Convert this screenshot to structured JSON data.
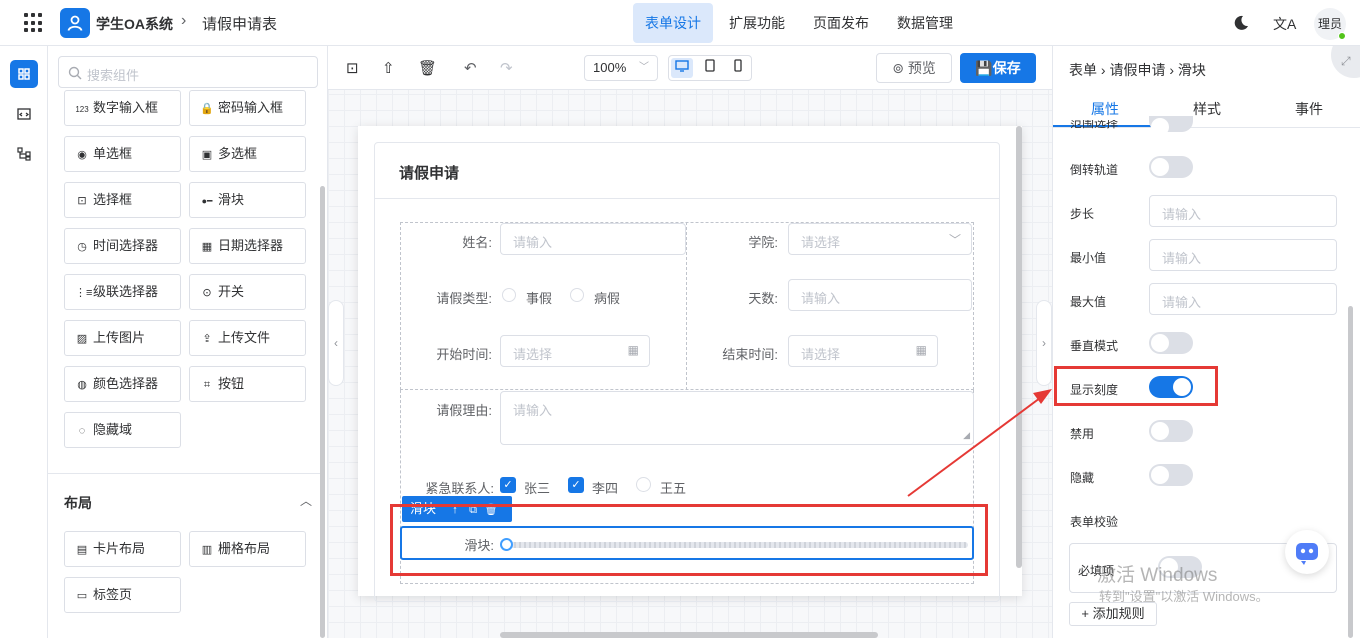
{
  "app": {
    "title": "学生OA系统",
    "page_name": "请假申请表",
    "crumb_sep": "›"
  },
  "topnav": [
    {
      "label": "表单设计",
      "active": true
    },
    {
      "label": "扩展功能"
    },
    {
      "label": "页面发布"
    },
    {
      "label": "数据管理"
    }
  ],
  "user": {
    "name": "理员"
  },
  "icons": {
    "translate": "文A"
  },
  "components": {
    "search_placeholder": "搜索组件",
    "items": [
      {
        "label": "数字输入框",
        "icon": "123"
      },
      {
        "label": "密码输入框",
        "icon": "🔒"
      },
      {
        "label": "单选框",
        "icon": "◉"
      },
      {
        "label": "多选框",
        "icon": "▣"
      },
      {
        "label": "选择框",
        "icon": "⊡"
      },
      {
        "label": "滑块",
        "icon": "●━"
      },
      {
        "label": "时间选择器",
        "icon": "◷"
      },
      {
        "label": "日期选择器",
        "icon": "▦"
      },
      {
        "label": "级联选择器",
        "icon": "⋮≡"
      },
      {
        "label": "开关",
        "icon": "⊙"
      },
      {
        "label": "上传图片",
        "icon": "▨"
      },
      {
        "label": "上传文件",
        "icon": "⇪"
      },
      {
        "label": "颜色选择器",
        "icon": "◍"
      },
      {
        "label": "按钮",
        "icon": "⌗"
      },
      {
        "label": "隐藏域",
        "icon": "◌"
      }
    ],
    "layout_title": "布局",
    "layout_items": [
      {
        "label": "卡片布局",
        "icon": "▤"
      },
      {
        "label": "栅格布局",
        "icon": "▥"
      },
      {
        "label": "标签页",
        "icon": "▭"
      }
    ]
  },
  "toolbar": {
    "zoom": "100%",
    "preview": "预览",
    "save": "保存"
  },
  "form": {
    "title": "请假申请",
    "name_label": "姓名:",
    "name_ph": "请输入",
    "college_label": "学院:",
    "college_ph": "请选择",
    "type_label": "请假类型:",
    "type_options": [
      "事假",
      "病假"
    ],
    "days_label": "天数:",
    "days_ph": "请输入",
    "start_label": "开始时间:",
    "start_ph": "请选择",
    "end_label": "结束时间:",
    "end_ph": "请选择",
    "reason_label": "请假理由:",
    "reason_ph": "请输入",
    "contact_label": "紧急联系人:",
    "contacts": [
      {
        "label": "张三",
        "checked": true
      },
      {
        "label": "李四",
        "checked": true
      },
      {
        "label": "王五",
        "checked": false
      }
    ],
    "selected_tag": "滑块",
    "slider_label": "滑块:",
    "slider_value": 0
  },
  "props": {
    "crumb": "表单 › 请假申请 › 滑块",
    "tabs": [
      "属性",
      "样式",
      "事件"
    ],
    "active_tab": "属性",
    "partial_label": "范围选择",
    "reverse_label": "倒转轨道",
    "step_label": "步长",
    "step_ph": "请输入",
    "min_label": "最小值",
    "min_ph": "请输入",
    "max_label": "最大值",
    "max_ph": "请输入",
    "vertical_label": "垂直模式",
    "show_stops_label": "显示刻度",
    "disabled_label": "禁用",
    "hidden_label": "隐藏",
    "validate_label": "表单校验",
    "required_label": "必填项",
    "add_rule": "+ 添加规则",
    "switches": {
      "reverse": false,
      "vertical": false,
      "show_stops": true,
      "disabled": false,
      "hidden": false,
      "required": false
    }
  },
  "watermark": {
    "line1": "激活 Windows",
    "line2": "转到\"设置\"以激活 Windows。"
  }
}
